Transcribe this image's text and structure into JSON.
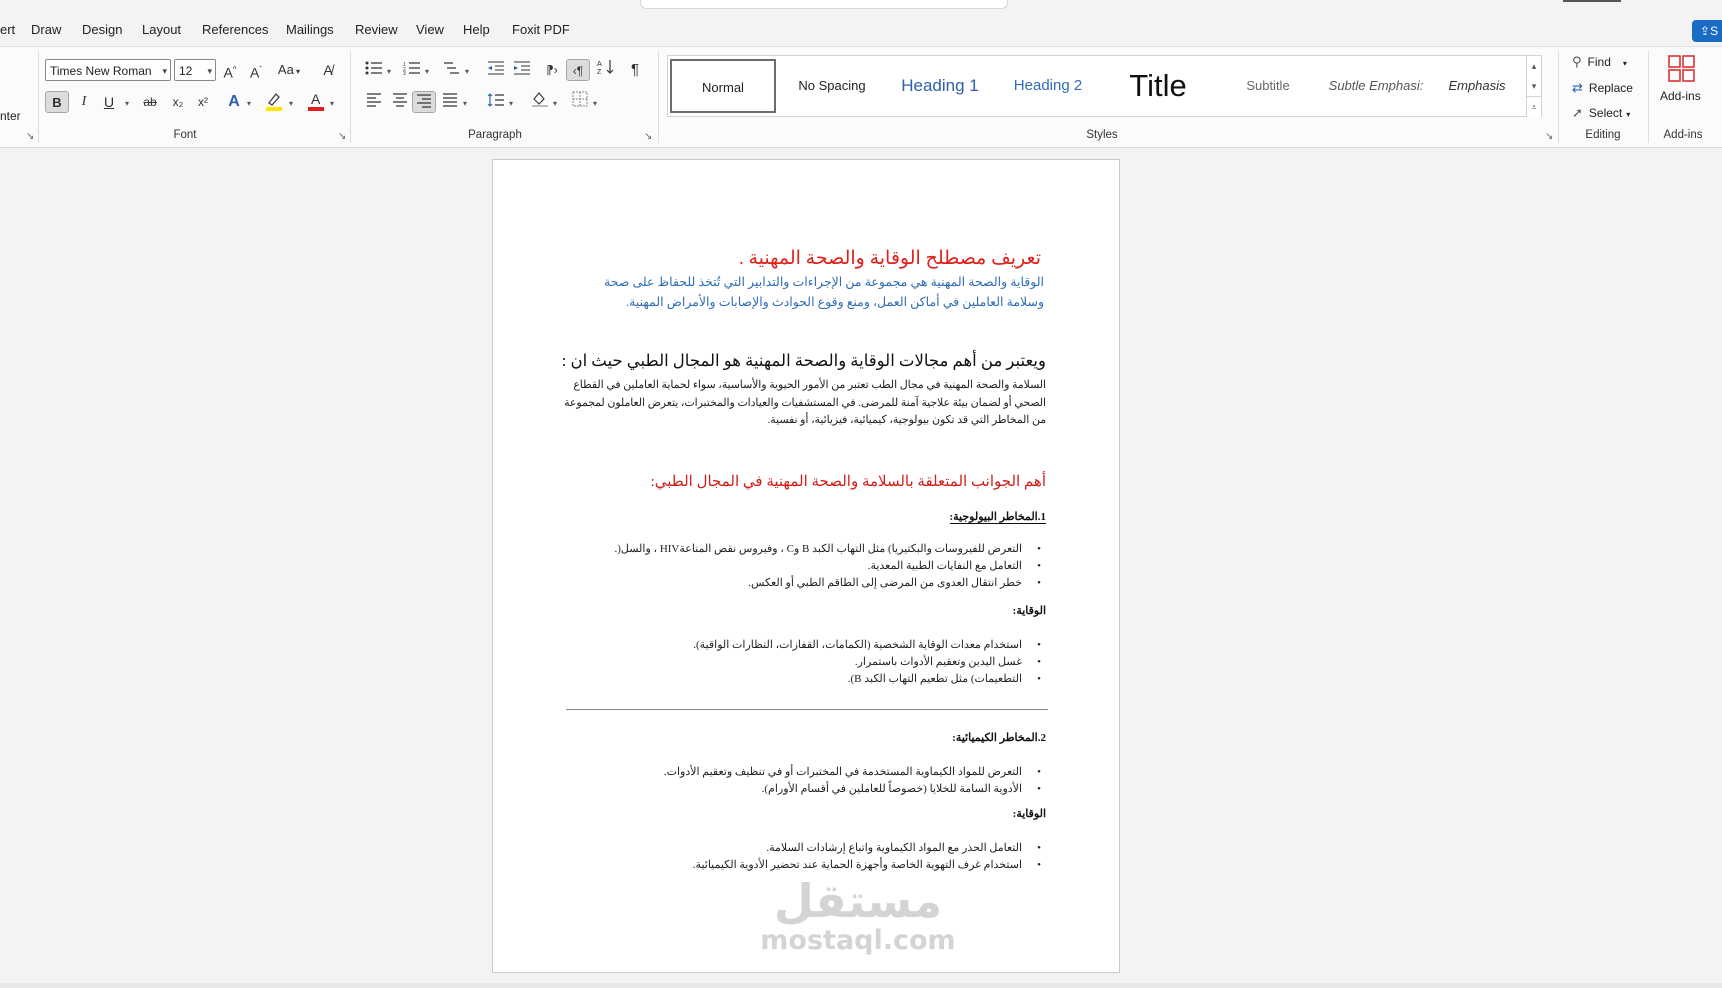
{
  "menu": {
    "partial_tab": "ert",
    "tabs": [
      "Draw",
      "Design",
      "Layout",
      "References",
      "Mailings",
      "Review",
      "View",
      "Help",
      "Foxit PDF"
    ],
    "share_label": "S"
  },
  "ribbon": {
    "clipboard_partial": "nter",
    "font": {
      "group_label": "Font",
      "font_name": "Times New Roman",
      "font_size": "12",
      "grow_icon": "A^",
      "shrink_icon": "A˅",
      "case_label": "Aa",
      "bold": "B",
      "italic": "I",
      "underline": "U",
      "strike": "ab",
      "subscript": "x₂",
      "superscript": "x²",
      "effects": "A",
      "highlight_color": "#ffe600",
      "font_color": "#e0201b"
    },
    "paragraph": {
      "group_label": "Paragraph"
    },
    "styles": {
      "group_label": "Styles",
      "items": [
        {
          "label": "Normal"
        },
        {
          "label": "No Spacing"
        },
        {
          "label": "Heading 1"
        },
        {
          "label": "Heading 2"
        },
        {
          "label": "Title"
        },
        {
          "label": "Subtitle"
        },
        {
          "label": "Subtle Emphasi:"
        },
        {
          "label": "Emphasis"
        }
      ],
      "selected": "Normal"
    },
    "editing": {
      "group_label": "Editing",
      "find": "Find",
      "replace": "Replace",
      "select": "Select"
    },
    "addins": {
      "group_label": "Add-ins",
      "button_label": "Add-ins"
    }
  },
  "document": {
    "title": "تعريف مصطلح الوقاية والصحة المهنية .",
    "definition": "الوقاية والصحة المهنية هي مجموعة من الإجراءات والتدابير التي تُتخذ للحفاظ على صحة وسلامة العاملين في أماكن العمل، ومنع وقوع الحوادث والإصابات والأمراض المهنية.",
    "heading2": "ويعتبر من أهم مجالات الوقاية والصحة المهنية هو المجال الطبي حيث ان :",
    "paragraph2": "السلامة والصحة المهنية في مجال الطب تعتبر من الأمور الحيوية والأساسية، سواء لحماية العاملين في القطاع الصحي أو لضمان بيئة علاجية آمنة للمرضى. في المستشفيات والعيادات والمختبرات، يتعرض العاملون لمجموعة من المخاطر التي قد تكون بيولوجية، كيميائية، فيزيائية، أو نفسية.",
    "heading3": "أهم الجوانب المتعلقة بالسلامة والصحة المهنية في المجال الطبي:",
    "section1": {
      "title": "1.المخاطر البيولوجية:",
      "risks": [
        "التعرض للفيروسات والبكتيريا) مثل التهاب الكبد B وC ، وفيروس نقص المناعةHIV ، والسل(.",
        "التعامل مع النفايات الطبية المعدية.",
        "خطر انتقال العدوى من المرضى إلى الطاقم الطبي أو العكس."
      ],
      "prevention_title": "الوقاية:",
      "prevention": [
        "استخدام معدات الوقاية الشخصية (الكمامات، القفازات، النظارات الواقية).",
        "غسل اليدين وتعقيم الأدوات باستمرار.",
        "التطعيمات) مثل تطعيم التهاب الكبد B)."
      ]
    },
    "section2": {
      "title": "2.المخاطر الكيميائية:",
      "risks": [
        "التعرض للمواد الكيماوية المستخدمة في المختبرات أو في تنظيف وتعقيم الأدوات.",
        "الأدوية السامة للخلايا (خصوصاً للعاملين في أقسام الأورام)."
      ],
      "prevention_title": "الوقاية:",
      "prevention": [
        "التعامل الحذر مع المواد الكيماوية واتباع إرشادات السلامة.",
        "استخدام غرف التهوية الخاصة وأجهزة الحماية عند تحضير الأدوية الكيميائية."
      ]
    },
    "watermark_arabic": "مستقل",
    "watermark_latin": "mostaql.com"
  }
}
